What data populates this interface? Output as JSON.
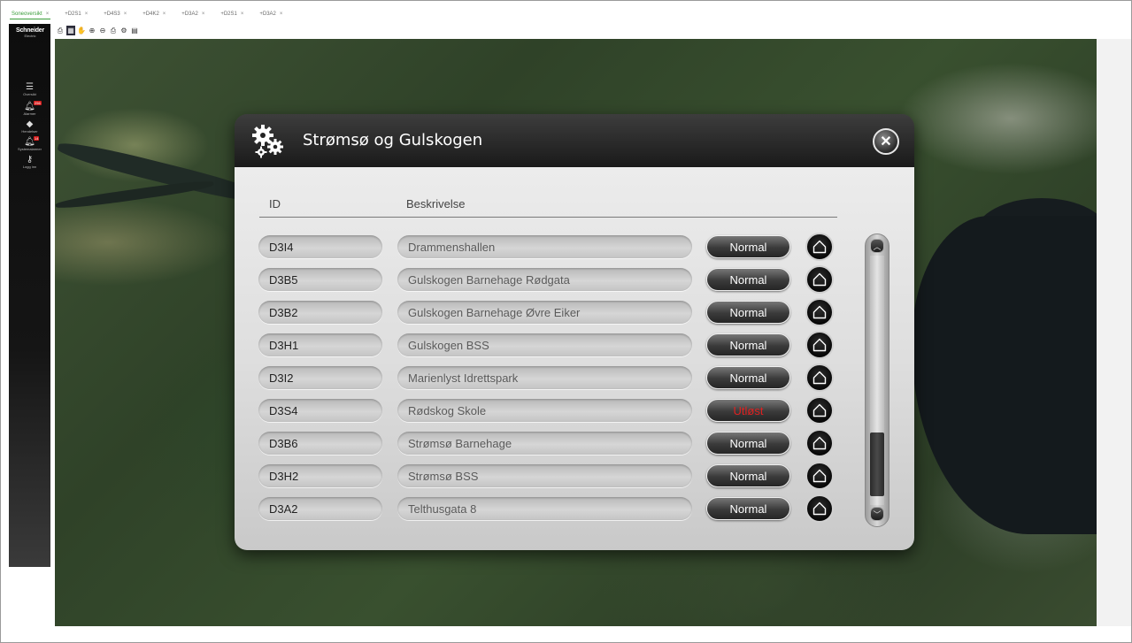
{
  "tabs": [
    {
      "label": "Soneoversikt",
      "close": "×",
      "active": true
    },
    {
      "label": "+D2S1",
      "close": "×"
    },
    {
      "label": "+D4S3",
      "close": "×"
    },
    {
      "label": "+D4K2",
      "close": "×"
    },
    {
      "label": "+D3A2",
      "close": "×"
    },
    {
      "label": "+D2S1",
      "close": "×"
    },
    {
      "label": "+D3A2",
      "close": "×"
    }
  ],
  "toolbar": {
    "icons": [
      "print-icon",
      "layers-icon",
      "hand-pan-icon",
      "zoom-in-icon",
      "zoom-out-icon",
      "print-preview-icon",
      "printer-settings-icon",
      "document-icon"
    ]
  },
  "sidebar": {
    "logo_line1": "Schneider",
    "logo_line2": "Electric",
    "items": [
      {
        "label": "Oversikt",
        "icon": "overview-icon"
      },
      {
        "label": "Alarmer",
        "icon": "bell-icon",
        "badge": "256"
      },
      {
        "label": "Hendelser",
        "icon": "diamond-icon"
      },
      {
        "label": "Systemalarmer",
        "icon": "bell-icon",
        "badge": "14"
      },
      {
        "label": "Logg inn",
        "icon": "key-icon"
      }
    ]
  },
  "dialog": {
    "title": "Strømsø og Gulskogen",
    "close_label": "✕",
    "columns": {
      "id": "ID",
      "description": "Beskrivelse"
    },
    "rows": [
      {
        "id": "D3I4",
        "description": "Drammenshallen",
        "status": "Normal",
        "alarm": false
      },
      {
        "id": "D3B5",
        "description": "Gulskogen Barnehage Rødgata",
        "status": "Normal",
        "alarm": false
      },
      {
        "id": "D3B2",
        "description": "Gulskogen Barnehage Øvre Eiker",
        "status": "Normal",
        "alarm": false
      },
      {
        "id": "D3H1",
        "description": "Gulskogen BSS",
        "status": "Normal",
        "alarm": false
      },
      {
        "id": "D3I2",
        "description": "Marienlyst Idrettspark",
        "status": "Normal",
        "alarm": false
      },
      {
        "id": "D3S4",
        "description": "Rødskog Skole",
        "status": "Utløst",
        "alarm": true
      },
      {
        "id": "D3B6",
        "description": "Strømsø Barnehage",
        "status": "Normal",
        "alarm": false
      },
      {
        "id": "D3H2",
        "description": "Strømsø BSS",
        "status": "Normal",
        "alarm": false
      },
      {
        "id": "D3A2",
        "description": "Telthusgata 8",
        "status": "Normal",
        "alarm": false
      }
    ]
  },
  "colors": {
    "active_tab": "#3a9d3a",
    "alarm_text": "#e02020",
    "normal_text": "#ffffff"
  }
}
